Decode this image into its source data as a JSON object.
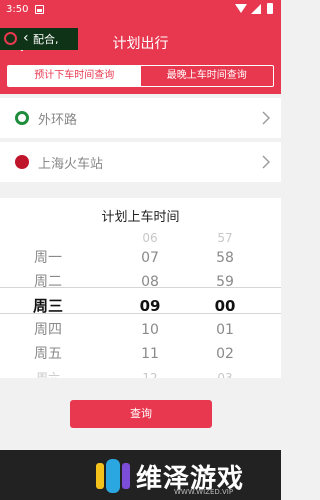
{
  "status_bar": {
    "time": "3:50"
  },
  "header": {
    "title": "计划出行",
    "back_icon": "arrow-left-icon"
  },
  "tabs": [
    {
      "label": "预计下车时间查询",
      "active": true
    },
    {
      "label": "最晚上车时间查询",
      "active": false
    }
  ],
  "stations": {
    "from": {
      "name": "外环路",
      "icon": "ring-marker-icon"
    },
    "to": {
      "name": "上海火车站",
      "icon": "dot-marker-icon"
    }
  },
  "picker": {
    "title": "计划上车时间",
    "days": [
      "周一",
      "周二",
      "周三",
      "周四",
      "周五",
      "周六"
    ],
    "hours": [
      "06",
      "07",
      "08",
      "09",
      "10",
      "11",
      "12"
    ],
    "minutes": [
      "57",
      "58",
      "59",
      "00",
      "01",
      "02",
      "03"
    ],
    "selected": {
      "day": "周三",
      "hour": "09",
      "minute": "00"
    }
  },
  "query_button": {
    "label": "查询"
  },
  "bottom_overlay": {
    "left_text": "配合,",
    "watermark_text": "维泽游戏",
    "watermark_url": "WWW.WIZED.VIP"
  },
  "colors": {
    "accent": "#e8384f",
    "from_marker": "#1e8c3a",
    "to_marker": "#c0142a"
  }
}
